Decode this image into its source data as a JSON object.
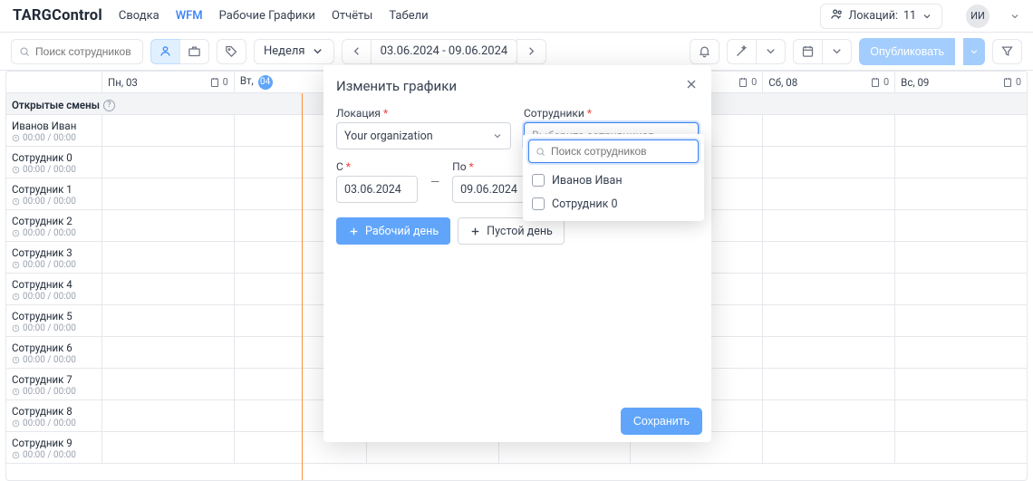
{
  "brand": "TARGControl",
  "nav": {
    "items": [
      "Сводка",
      "WFM",
      "Рабочие Графики",
      "Отчёты",
      "Табели"
    ],
    "active": 1
  },
  "location": {
    "label": "Локаций:",
    "count": "11"
  },
  "avatar": "ИИ",
  "toolbar": {
    "search_placeholder": "Поиск сотрудников",
    "period_label": "Неделя",
    "date_range": "03.06.2024 - 09.06.2024",
    "publish": "Опубликовать"
  },
  "grid": {
    "open_shifts": "Открытые смены",
    "days": [
      {
        "label": "Пн, 03",
        "count": "0"
      },
      {
        "label": "Вт,",
        "today": "04",
        "count": ""
      },
      {
        "label": "",
        "count": ""
      },
      {
        "label": "",
        "count": ""
      },
      {
        "label": "",
        "count": "0"
      },
      {
        "label": "Сб, 08",
        "count": "0"
      },
      {
        "label": "Вс, 09",
        "count": "0"
      }
    ],
    "rows": [
      {
        "name": "Иванов Иван",
        "time": "00:00 / 00:00"
      },
      {
        "name": "Сотрудник 0",
        "time": "00:00 / 00:00"
      },
      {
        "name": "Сотрудник 1",
        "time": "00:00 / 00:00"
      },
      {
        "name": "Сотрудник 2",
        "time": "00:00 / 00:00"
      },
      {
        "name": "Сотрудник 3",
        "time": "00:00 / 00:00"
      },
      {
        "name": "Сотрудник 4",
        "time": "00:00 / 00:00"
      },
      {
        "name": "Сотрудник 5",
        "time": "00:00 / 00:00"
      },
      {
        "name": "Сотрудник 6",
        "time": "00:00 / 00:00"
      },
      {
        "name": "Сотрудник 7",
        "time": "00:00 / 00:00"
      },
      {
        "name": "Сотрудник 8",
        "time": "00:00 / 00:00"
      },
      {
        "name": "Сотрудник 9",
        "time": "00:00 / 00:00"
      }
    ]
  },
  "modal": {
    "title": "Изменить графики",
    "location_label": "Локация",
    "location_value": "Your organization",
    "employees_label": "Сотрудники",
    "employees_placeholder": "Выберите сотрудников",
    "from_label": "С",
    "from_value": "03.06.2024",
    "to_label": "По",
    "to_value": "09.06.2024",
    "workday": "Рабочий день",
    "emptyday": "Пустой день",
    "save": "Сохранить"
  },
  "dropdown": {
    "search_placeholder": "Поиск сотрудников",
    "items": [
      "Иванов Иван",
      "Сотрудник 0"
    ]
  }
}
